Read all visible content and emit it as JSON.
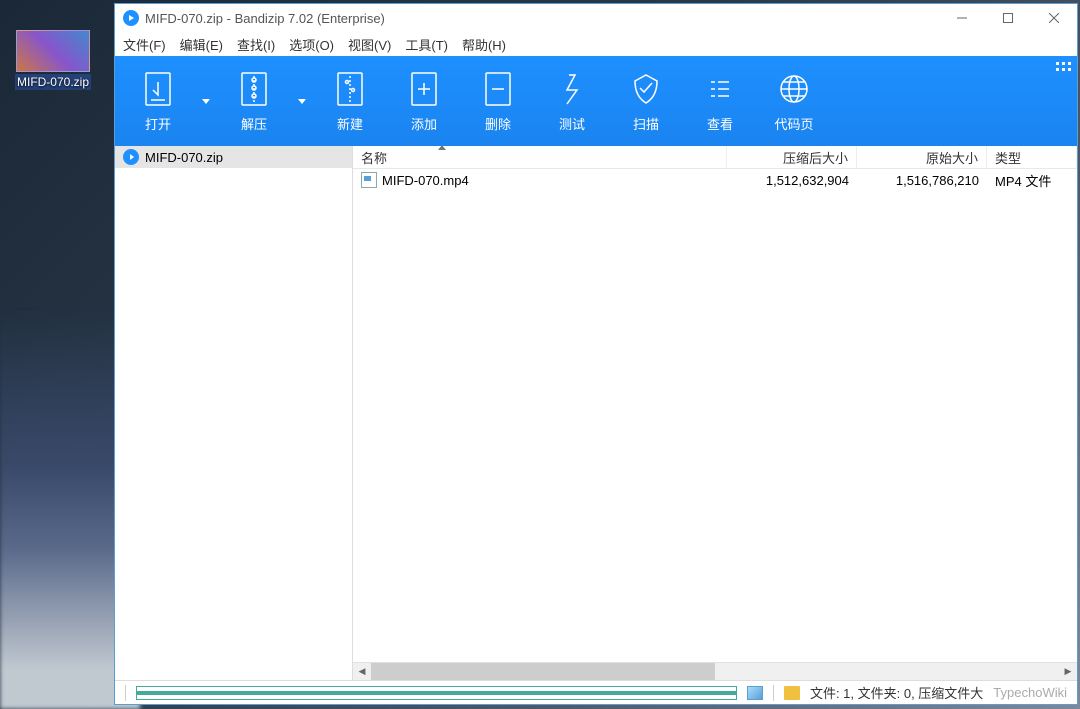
{
  "desktop": {
    "icon_label": "MIFD-070.zip"
  },
  "window": {
    "title": "MIFD-070.zip - Bandizip 7.02 (Enterprise)",
    "controls": {
      "min": "—",
      "max": "☐",
      "close": "✕"
    }
  },
  "menu": {
    "file": "文件(F)",
    "edit": "编辑(E)",
    "find": "查找(I)",
    "options": "选项(O)",
    "view": "视图(V)",
    "tools": "工具(T)",
    "help": "帮助(H)"
  },
  "toolbar": {
    "open": "打开",
    "extract": "解压",
    "new": "新建",
    "add": "添加",
    "delete": "删除",
    "test": "测试",
    "scan": "扫描",
    "view": "查看",
    "codepage": "代码页"
  },
  "tree": {
    "root": "MIFD-070.zip"
  },
  "columns": {
    "name": "名称",
    "packed": "压缩后大小",
    "original": "原始大小",
    "type": "类型"
  },
  "files": [
    {
      "name": "MIFD-070.mp4",
      "packed": "1,512,632,904",
      "original": "1,516,786,210",
      "type": "MP4 文件"
    }
  ],
  "status": {
    "text": "文件: 1, 文件夹: 0, 压缩文件大",
    "watermark": "TypechoWiki"
  }
}
